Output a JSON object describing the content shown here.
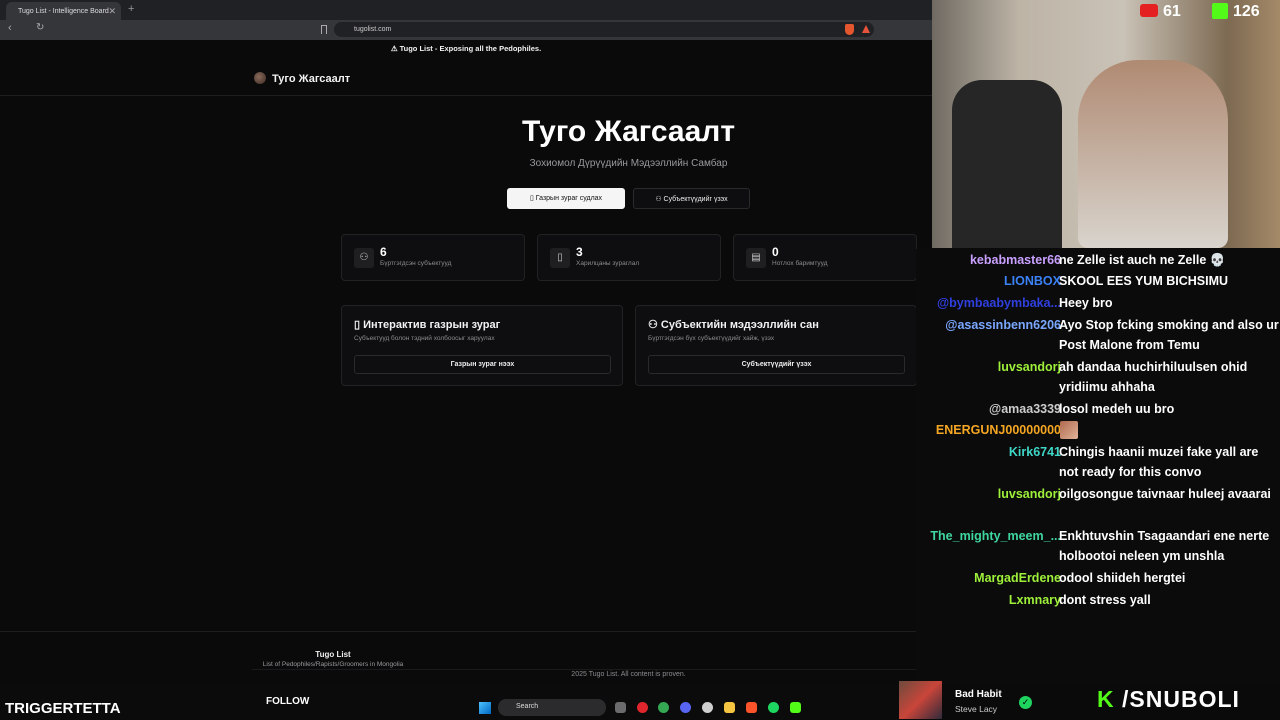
{
  "browser": {
    "tab_title": "Tugo List - Intelligence Board",
    "tab_close": "✕",
    "new_tab": "+",
    "url": "tugolist.com",
    "back": "‹",
    "reload": "↻"
  },
  "page": {
    "banner": "⚠ Tugo List - Exposing all the Pedophiles.",
    "brand": "Туго Жагсаалт",
    "hero_title": "Туго Жагсаалт",
    "hero_subtitle": "Зохиомол Дүрүүдийн Мэдээллийн Самбар",
    "btn_map": "Газрын зураг судлах",
    "btn_subjects": "Субъектүүдийг үзэх",
    "stats": [
      {
        "num": "6",
        "label": "Бүртгэгдсэн субъектууд",
        "icon": "users-icon"
      },
      {
        "num": "3",
        "label": "Харилцаны зураглал",
        "icon": "map-icon"
      },
      {
        "num": "0",
        "label": "Нотлох баримтууд",
        "icon": "document-icon"
      }
    ],
    "cards": [
      {
        "title": "Интерактив газрын зураг",
        "subtitle": "Субъектууд болон тэдний холбоосыг харуулах",
        "button": "Газрын зураг нээх"
      },
      {
        "title": "Субъектийн мэдээллийн сан",
        "subtitle": "Бүртгэгдсэн бүх субъектүүдийг хайж, үзэх",
        "button": "Субъектүүдийг үзэх"
      }
    ],
    "footer_title": "Tugo List",
    "footer_subtitle": "List of Pedophiles/Rapists/Groomers in Mongolia",
    "footer_copy": "2025 Tugo List. All content is proven."
  },
  "stream": {
    "yt_count": "61",
    "kick_count": "126",
    "streamer_name": "TRIGGERTETTA",
    "follow_label": "FOLLOW",
    "search_label": "Search",
    "now_playing_title": "Bad Habit",
    "now_playing_artist": "Steve Lacy",
    "kick_handle": "/SNUBOLI"
  },
  "chat": [
    {
      "user": "kebabmaster66",
      "color": "#c9a0ff",
      "text": "ne Zelle ist auch ne Zelle 💀"
    },
    {
      "user": "LIONBOX",
      "color": "#3b82f6",
      "text": "SKOOL EES YUM BICHSIMU"
    },
    {
      "user": "@bymbaabymbaka...",
      "color": "#2f3fe0",
      "text": "Heey bro"
    },
    {
      "user": "@asassinbenn6206",
      "color": "#7aa7ff",
      "text": "Ayo Stop fcking smoking and also ur Post Malone from Temu"
    },
    {
      "user": "luvsandorj",
      "color": "#9ef03a",
      "text": "ah dandaa huchirhiluulsen ohid yridiimu ahhaha"
    },
    {
      "user": "@amaa3339",
      "color": "#cccccc",
      "text": "losol medeh uu bro"
    },
    {
      "user": "ENERGUNJ00000000",
      "color": "#f5a623",
      "text": ""
    },
    {
      "user": "Kirk6741",
      "color": "#3fd6c6",
      "text": "Chingis haanii muzei fake yall are not ready for this convo"
    },
    {
      "user": "luvsandorj",
      "color": "#9ef03a",
      "text": "oilgosongue taivnaar huleej avaarai"
    },
    {
      "user": "The_mighty_meem_...",
      "color": "#3fd6a0",
      "text": "Enkhtuvshin Tsagaandari ene nerte holbootoi neleen ym unshla"
    },
    {
      "user": "MargadErdene",
      "color": "#9ef03a",
      "text": "odool shiideh hergtei"
    },
    {
      "user": "Lxmnary",
      "color": "#9ef03a",
      "text": "dont stress yall"
    }
  ]
}
